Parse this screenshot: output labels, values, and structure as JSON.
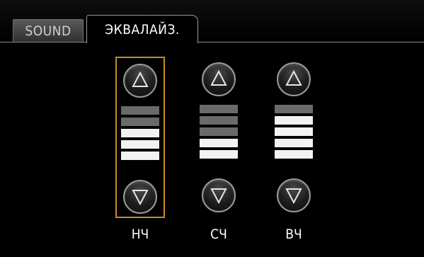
{
  "tabs": [
    {
      "label": "SOUND",
      "active": false
    },
    {
      "label": "ЭКВАЛАЙЗ.",
      "active": true
    }
  ],
  "bands": [
    {
      "label": "НЧ",
      "level": 3,
      "segments": 5,
      "selected": true
    },
    {
      "label": "СЧ",
      "level": 2,
      "segments": 5,
      "selected": false
    },
    {
      "label": "ВЧ",
      "level": 4,
      "segments": 5,
      "selected": false
    }
  ],
  "icons": {
    "up": "triangle-up-icon",
    "down": "triangle-down-icon"
  },
  "colors": {
    "background": "#000000",
    "selection_border": "#c98a2a",
    "segment_on": "#f2f2f2",
    "segment_off": "#6a6a6a"
  }
}
